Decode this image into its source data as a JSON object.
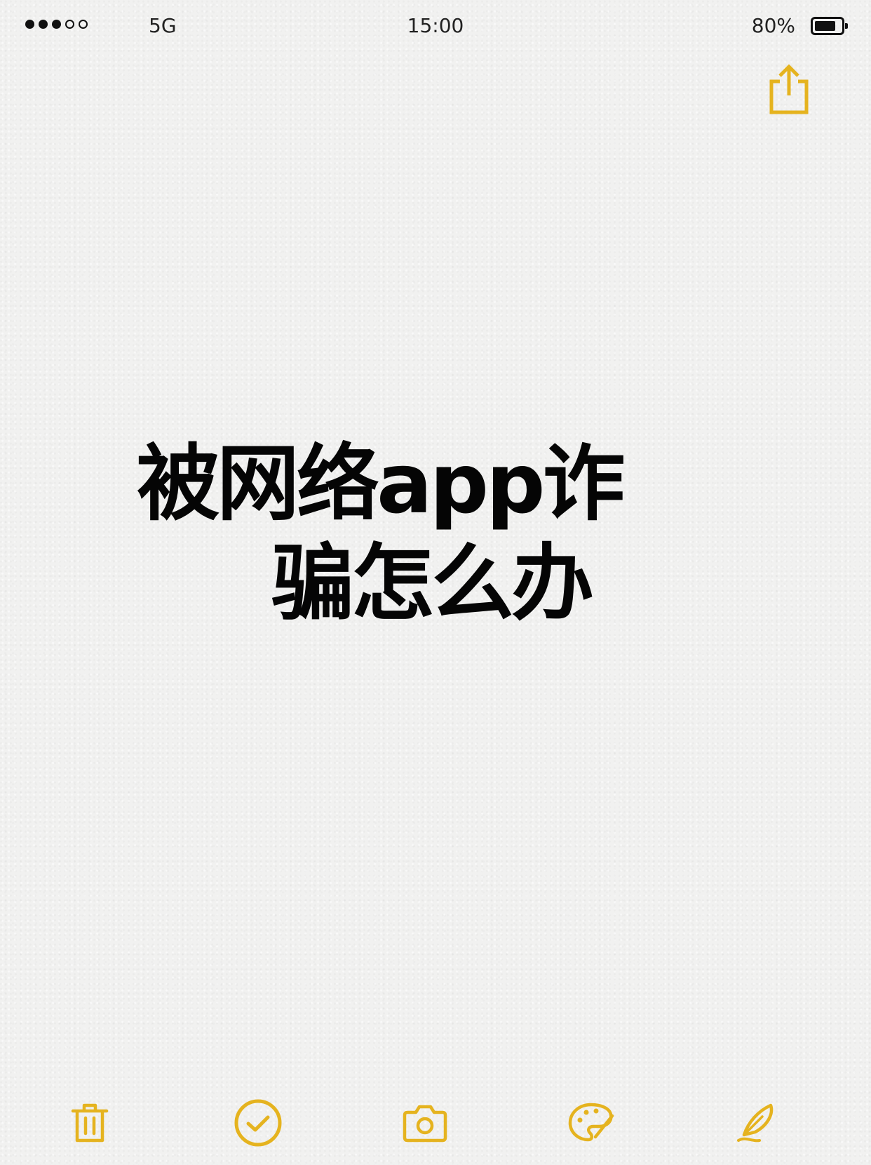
{
  "status_bar": {
    "signal_filled": 3,
    "signal_total": 5,
    "network": "5G",
    "time": "15:00",
    "battery_percent": "80%",
    "battery_level": 0.8
  },
  "note": {
    "title_line1": "被网络app诈",
    "title_line2": "骗怎么办"
  },
  "toolbar": {
    "items": [
      {
        "icon": "trash-icon"
      },
      {
        "icon": "checklist-icon"
      },
      {
        "icon": "camera-icon"
      },
      {
        "icon": "palette-icon"
      },
      {
        "icon": "pen-icon"
      }
    ]
  },
  "colors": {
    "accent": "#e5b31f",
    "text": "#050505",
    "background": "#f1f1f0"
  }
}
